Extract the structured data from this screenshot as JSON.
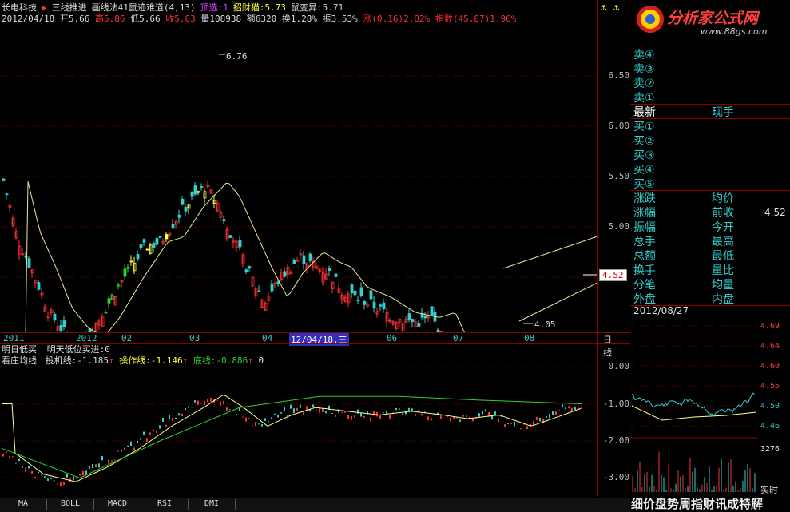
{
  "header": {
    "stock_name": "长电科技",
    "indicator_name": "三线推进",
    "indicator2": "画线法41鼠迹难道(4,13)",
    "top_sel": "顶选:1",
    "zhaocai": "招财猫:5.73",
    "shubian": "鼠变异:5.71",
    "date": "2012/04/18",
    "open": "开5.66",
    "high": "高5.86",
    "low": "低5.66",
    "close": "收5.83",
    "volume": "量108938",
    "amount": "额6320",
    "turnover": "换1.28%",
    "amplitude": "振3.53%",
    "change": "涨(0.16)2.82%",
    "index": "指数(45.87)1.96%"
  },
  "main_chart": {
    "y_ticks": [
      "6.50",
      "6.00",
      "5.50",
      "5.00"
    ],
    "high_label": "6.76",
    "low_label": "4.05",
    "last_price": "4.52",
    "x_labels": [
      "2011",
      "2012",
      "02",
      "03",
      "04",
      "12/04/18,三",
      "06",
      "07",
      "08"
    ],
    "period": "日线"
  },
  "sub_chart": {
    "title_line1_a": "明日低买",
    "title_line1_b": "明天低位买进:0",
    "title_line2_a": "看庄均线",
    "title_line2_b": "投机线:-1.185",
    "title_line2_c": "操作线:-1.146",
    "title_line2_d": "底线:-0.886",
    "title_line2_e": "0",
    "y_ticks": [
      "0.00",
      "-1.00",
      "-2.00",
      "-3.00"
    ]
  },
  "tabs": [
    "MA",
    "BOLL",
    "MACD",
    "RSI",
    "DMI"
  ],
  "panel": {
    "logo_text": "分析家公式网",
    "logo_url": "www.88gs.com",
    "sells": [
      "卖④",
      "卖③",
      "卖②",
      "卖①"
    ],
    "latest": "最新",
    "hand": "现手",
    "buys": [
      "买①",
      "买②",
      "买③",
      "买④",
      "买⑤"
    ],
    "left_labels": [
      "涨跌",
      "涨幅",
      "振幅",
      "总手",
      "总额",
      "换手",
      "分笔",
      "外盘"
    ],
    "right_labels": [
      "均价",
      "前收",
      "今开",
      "最高",
      "最低",
      "量比",
      "均量",
      "内盘"
    ],
    "prev_close_value": "4.52",
    "mini_date": "2012/08/27",
    "mini_ticks": [
      "4.69",
      "4.64",
      "4.60",
      "4.55",
      "4.50",
      "4.46"
    ],
    "mini_vol": "3276",
    "realtime": "实时",
    "bottom_text": "细价盘势周指财讯成特解"
  },
  "colors": {
    "up": "#ff3030",
    "down": "#33d0d0",
    "grid": "#8b0000",
    "yellow": "#ffff40",
    "green": "#30d030"
  }
}
